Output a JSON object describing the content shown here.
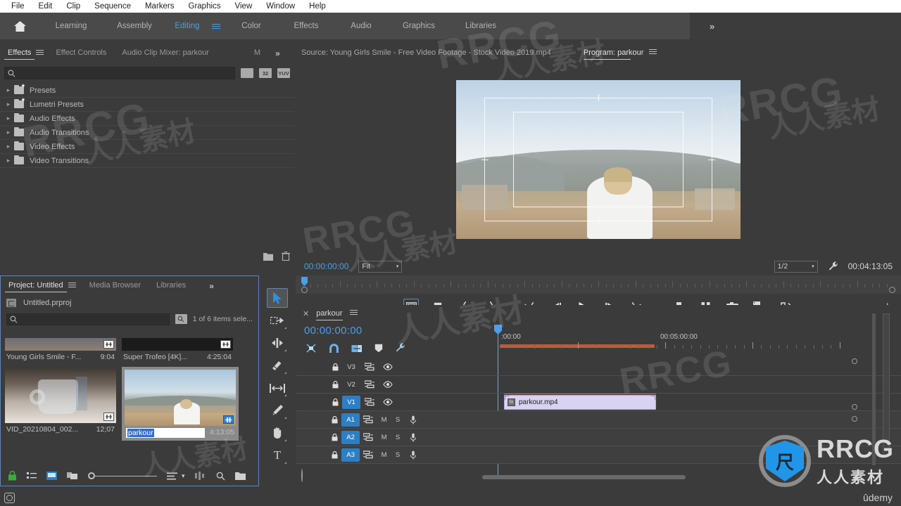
{
  "app": {
    "name": "Adobe Premiere Pro",
    "accent_blue": "#4b9fe8",
    "panel_bg": "#3b3b3b",
    "track_selected": "#2c7fc4"
  },
  "menubar": {
    "items": [
      "File",
      "Edit",
      "Clip",
      "Sequence",
      "Markers",
      "Graphics",
      "View",
      "Window",
      "Help"
    ]
  },
  "workspace": {
    "home_icon": "home-icon",
    "tabs": [
      {
        "label": "Learning",
        "active": false
      },
      {
        "label": "Assembly",
        "active": false
      },
      {
        "label": "Editing",
        "active": true
      },
      {
        "label": "Color",
        "active": false
      },
      {
        "label": "Effects",
        "active": false
      },
      {
        "label": "Audio",
        "active": false
      },
      {
        "label": "Graphics",
        "active": false
      },
      {
        "label": "Libraries",
        "active": false
      }
    ],
    "overflow": "»"
  },
  "effects_panel": {
    "tabs": [
      {
        "label": "Effects",
        "active": true
      },
      {
        "label": "Effect Controls",
        "active": false
      },
      {
        "label": "Audio Clip Mixer: parkour",
        "active": false
      },
      {
        "label": "M",
        "active": false
      }
    ],
    "overflow": "»",
    "search": {
      "value": "",
      "placeholder": ""
    },
    "filter_buttons": [
      "accelerated-effect-icon",
      "32",
      "YUV"
    ],
    "tree": [
      {
        "label": "Presets",
        "icon": "folder-star-icon"
      },
      {
        "label": "Lumetri Presets",
        "icon": "folder-star-icon"
      },
      {
        "label": "Audio Effects",
        "icon": "folder-icon"
      },
      {
        "label": "Audio Transitions",
        "icon": "folder-icon"
      },
      {
        "label": "Video Effects",
        "icon": "folder-icon"
      },
      {
        "label": "Video Transitions",
        "icon": "folder-icon"
      }
    ],
    "footer_icons": [
      "new-custom-bin-icon",
      "delete-icon"
    ]
  },
  "project_panel": {
    "tabs": [
      {
        "label": "Project: Untitled",
        "active": true
      },
      {
        "label": "Media Browser",
        "active": false
      },
      {
        "label": "Libraries",
        "active": false
      }
    ],
    "overflow": "»",
    "project_file": "Untitled.prproj",
    "search": {
      "value": "",
      "placeholder": ""
    },
    "selection_status": "1 of 6 items sele...",
    "items": [
      {
        "name": "Young Girls Smile - F...",
        "duration": "9:04",
        "selected": false,
        "badge": "clip-icon"
      },
      {
        "name": "Super Trofeo [4K]...",
        "duration": "4:25:04",
        "selected": false,
        "badge": "clip-icon"
      },
      {
        "name": "VID_20210804_002...",
        "duration": "12;07",
        "selected": false,
        "badge": "clip-icon"
      },
      {
        "name": "parkour",
        "duration": "4:13:05",
        "selected": true,
        "renaming": true,
        "badge": "sequence-icon"
      }
    ],
    "footer_icons": [
      "lock-icon",
      "list-view-icon",
      "icon-view-icon",
      "freeform-view-icon",
      "zoom-slider",
      "sort-icon",
      "chevron-down-icon",
      "automate-to-sequence-icon",
      "find-icon",
      "new-bin-icon"
    ]
  },
  "tools_panel": {
    "tools": [
      {
        "name": "selection-tool",
        "active": true
      },
      {
        "name": "track-select-forward-tool",
        "active": false
      },
      {
        "name": "ripple-edit-tool",
        "active": false
      },
      {
        "name": "razor-tool",
        "active": false
      },
      {
        "name": "slip-tool",
        "active": false
      },
      {
        "name": "pen-tool",
        "active": false
      },
      {
        "name": "hand-tool",
        "active": false
      },
      {
        "name": "type-tool",
        "active": false
      }
    ]
  },
  "monitor": {
    "source_tab": "Source: Young Girls Smile - Free Video Footage - Stock Video 2019.mp4",
    "program_tab": "Program: parkour",
    "playhead_timecode": "00:00:00:00",
    "zoom_level": "Fit",
    "playback_resolution": "1/2",
    "duration_timecode": "00:04:13:05",
    "settings_icon": "wrench-icon",
    "transport_buttons": [
      {
        "name": "safe-margins-icon",
        "active": true
      },
      {
        "name": "add-marker-icon",
        "active": false
      },
      {
        "name": "mark-in-icon",
        "active": false
      },
      {
        "name": "mark-out-icon",
        "active": false
      },
      {
        "name": "go-to-in-icon",
        "active": false
      },
      {
        "name": "step-back-icon",
        "active": false
      },
      {
        "name": "play-stop-icon",
        "active": false
      },
      {
        "name": "step-forward-icon",
        "active": false
      },
      {
        "name": "go-to-out-icon",
        "active": false
      },
      {
        "name": "lift-icon",
        "active": false
      },
      {
        "name": "extract-icon",
        "active": false
      },
      {
        "name": "export-frame-icon",
        "active": false
      },
      {
        "name": "comparison-view-icon",
        "active": false
      },
      {
        "name": "button-editor-icon",
        "active": false
      }
    ],
    "add-button": "+"
  },
  "timeline": {
    "close_icon": "close-icon",
    "sequence_name": "parkour",
    "menu_icon": "panel-menu-icon",
    "timecode": "00:00:00:00",
    "tool_icons": [
      "nest-sequence-icon",
      "snap-icon",
      "linked-selection-icon",
      "add-marker-icon",
      "timeline-settings-icon"
    ],
    "ruler_labels": [
      {
        "text": ":00:00",
        "left_pct": 0
      },
      {
        "text": "00:05:00:00",
        "left_pct": 28
      }
    ],
    "video_tracks": [
      {
        "name": "V3",
        "selected": false
      },
      {
        "name": "V2",
        "selected": false
      },
      {
        "name": "V1",
        "selected": true
      }
    ],
    "audio_tracks": [
      {
        "name": "A1",
        "selected": true,
        "mute": "M",
        "solo": "S"
      },
      {
        "name": "A2",
        "selected": true,
        "mute": "M",
        "solo": "S"
      },
      {
        "name": "A3",
        "selected": true,
        "mute": "M",
        "solo": "S"
      }
    ],
    "clips": [
      {
        "name": "parkour.mp4",
        "track": "V1",
        "color": "#d9d2f0",
        "fx_badge": "fx-icon"
      }
    ],
    "track_icons": {
      "lock": "lock-icon",
      "targeting": "track-targeting-icon",
      "eye": "toggle-track-output-icon",
      "mic": "voice-over-record-icon"
    }
  },
  "statusbar": {
    "icon": "photoshop-no-icon"
  },
  "watermarks": {
    "brand_latin": "RRCG",
    "brand_cn": "人人素材",
    "udemy": "ûdemy",
    "logo_glyph": "尺"
  }
}
